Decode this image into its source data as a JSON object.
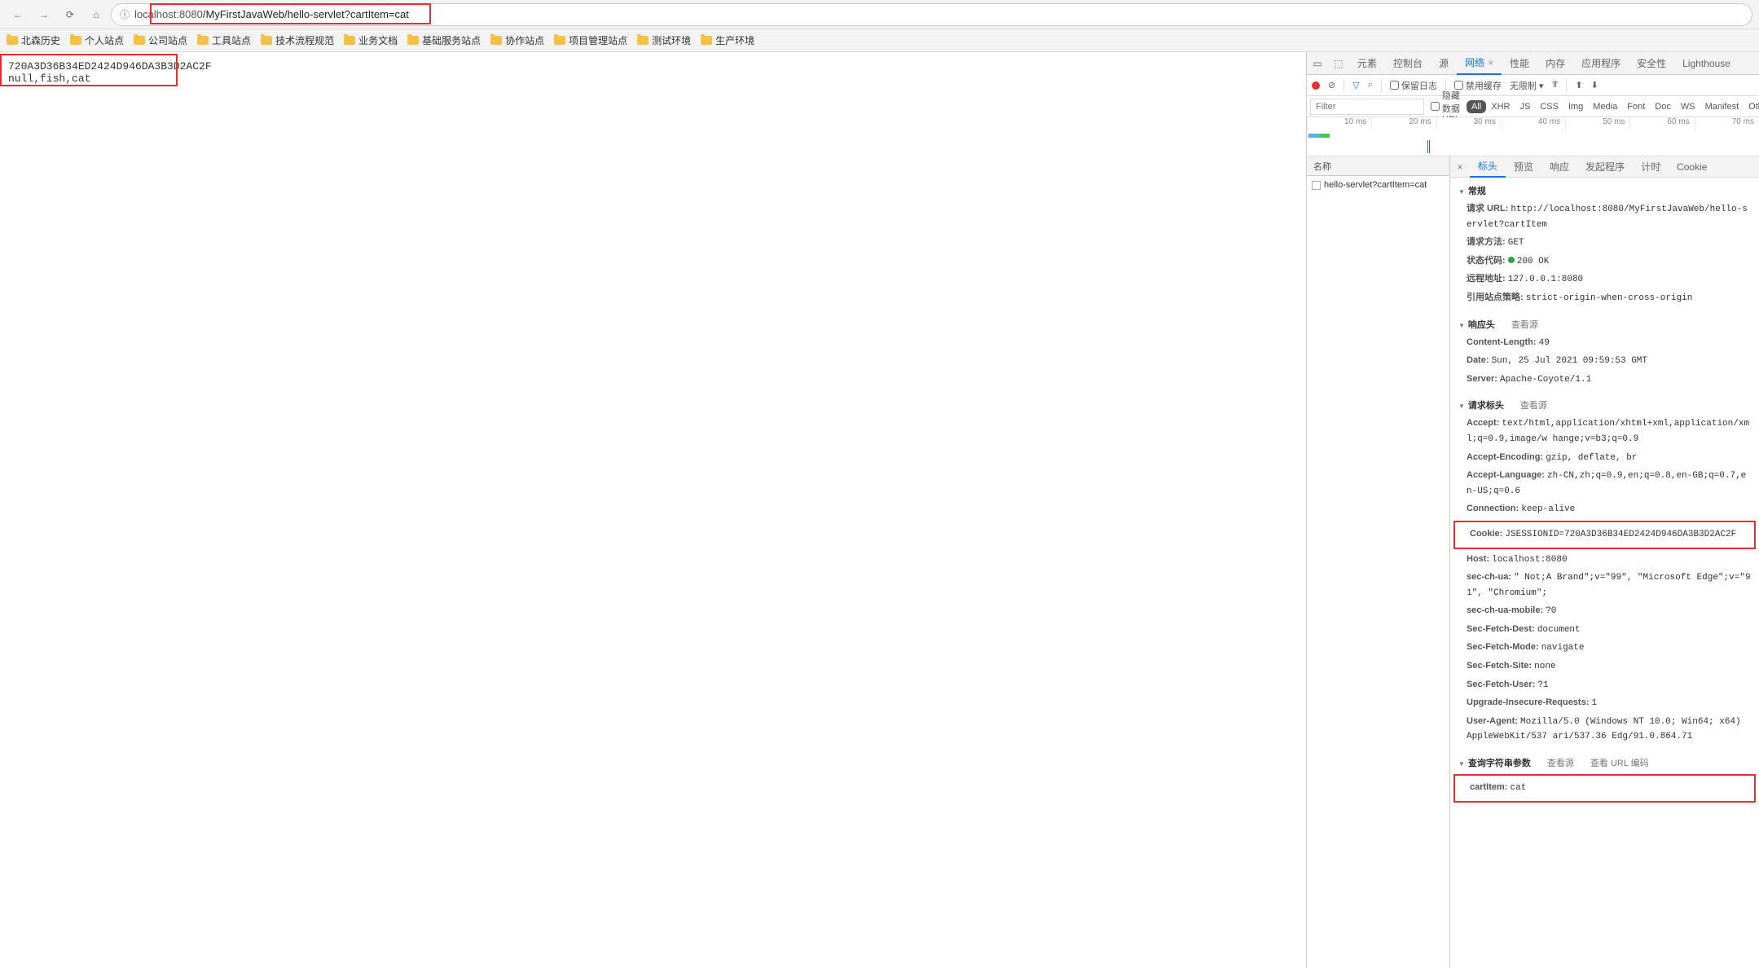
{
  "browser": {
    "url_host": "localhost",
    "url_port": ":8080",
    "url_path": "/MyFirstJavaWeb/hello-servlet?cartItem=cat"
  },
  "bookmarks": [
    "北森历史",
    "个人站点",
    "公司站点",
    "工具站点",
    "技术流程规范",
    "业务文档",
    "基础服务站点",
    "协作站点",
    "项目管理站点",
    "测试环境",
    "生产环境"
  ],
  "page_body": {
    "line1": "720A3D36B34ED2424D946DA3B3D2AC2F",
    "line2": "null,fish,cat"
  },
  "devtools": {
    "tabs": [
      "元素",
      "控制台",
      "源",
      "网络",
      "性能",
      "内存",
      "应用程序",
      "安全性",
      "Lighthouse"
    ],
    "active_tab": "网络",
    "toolbar": {
      "preserve_log": "保留日志",
      "disable_cache": "禁用缓存",
      "throttling": "无限制"
    },
    "filter": {
      "placeholder": "Filter",
      "hide_data_urls": "隐藏数据 URL",
      "types": [
        "All",
        "XHR",
        "JS",
        "CSS",
        "Img",
        "Media",
        "Font",
        "Doc",
        "WS",
        "Manifest",
        "Other"
      ]
    },
    "timeline_labels": [
      "10 ms",
      "20 ms",
      "30 ms",
      "40 ms",
      "50 ms",
      "60 ms",
      "70 ms"
    ],
    "request_list": {
      "header": "名称",
      "items": [
        "hello-servlet?cartItem=cat"
      ]
    },
    "detail_tabs": [
      "标头",
      "预览",
      "响应",
      "发起程序",
      "计时",
      "Cookie"
    ],
    "general": {
      "title": "常规",
      "request_url_label": "请求 URL:",
      "request_url": "http://localhost:8080/MyFirstJavaWeb/hello-servlet?cartItem",
      "request_method_label": "请求方法:",
      "request_method": "GET",
      "status_code_label": "状态代码:",
      "status_code": "200 OK",
      "remote_addr_label": "远程地址:",
      "remote_addr": "127.0.0.1:8080",
      "referrer_policy_label": "引用站点策略:",
      "referrer_policy": "strict-origin-when-cross-origin"
    },
    "response_headers": {
      "title": "响应头",
      "view_source": "查看源",
      "items": [
        {
          "k": "Content-Length:",
          "v": "49"
        },
        {
          "k": "Date:",
          "v": "Sun, 25 Jul 2021 09:59:53 GMT"
        },
        {
          "k": "Server:",
          "v": "Apache-Coyote/1.1"
        }
      ]
    },
    "request_headers": {
      "title": "请求标头",
      "view_source": "查看源",
      "items": [
        {
          "k": "Accept:",
          "v": "text/html,application/xhtml+xml,application/xml;q=0.9,image/w hange;v=b3;q=0.9"
        },
        {
          "k": "Accept-Encoding:",
          "v": "gzip, deflate, br"
        },
        {
          "k": "Accept-Language:",
          "v": "zh-CN,zh;q=0.9,en;q=0.8,en-GB;q=0.7,en-US;q=0.6"
        },
        {
          "k": "Connection:",
          "v": "keep-alive"
        },
        {
          "k": "Cookie:",
          "v": "JSESSIONID=720A3D36B34ED2424D946DA3B3D2AC2F",
          "highlight": true
        },
        {
          "k": "Host:",
          "v": "localhost:8080"
        },
        {
          "k": "sec-ch-ua:",
          "v": "\" Not;A Brand\";v=\"99\", \"Microsoft Edge\";v=\"91\", \"Chromium\";"
        },
        {
          "k": "sec-ch-ua-mobile:",
          "v": "?0"
        },
        {
          "k": "Sec-Fetch-Dest:",
          "v": "document"
        },
        {
          "k": "Sec-Fetch-Mode:",
          "v": "navigate"
        },
        {
          "k": "Sec-Fetch-Site:",
          "v": "none"
        },
        {
          "k": "Sec-Fetch-User:",
          "v": "?1"
        },
        {
          "k": "Upgrade-Insecure-Requests:",
          "v": "1"
        },
        {
          "k": "User-Agent:",
          "v": "Mozilla/5.0 (Windows NT 10.0; Win64; x64) AppleWebKit/537 ari/537.36 Edg/91.0.864.71"
        }
      ]
    },
    "query_params": {
      "title": "查询字符串参数",
      "view_source": "查看源",
      "view_url_encoded": "查看 URL 编码",
      "items": [
        {
          "k": "cartItem:",
          "v": "cat",
          "highlight": true
        }
      ]
    }
  }
}
